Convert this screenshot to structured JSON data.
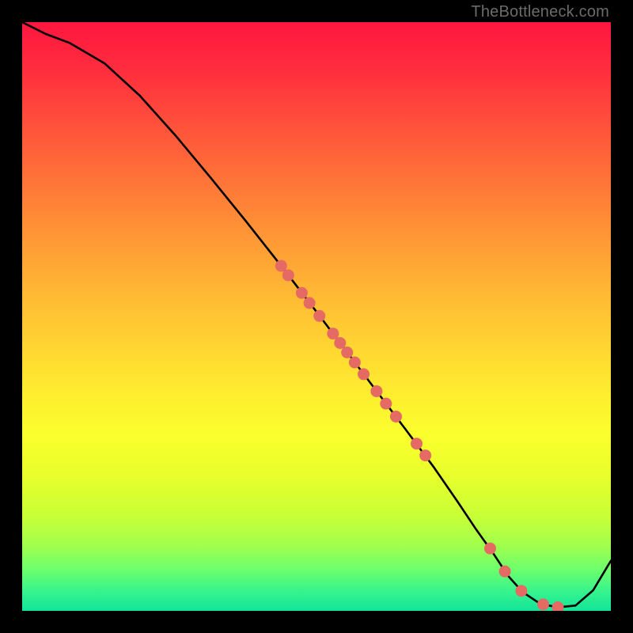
{
  "watermark": "TheBottleneck.com",
  "chart_data": {
    "type": "line",
    "title": "",
    "xlabel": "",
    "ylabel": "",
    "xlim": [
      0,
      100
    ],
    "ylim": [
      0,
      100
    ],
    "grid": false,
    "legend": false,
    "curve": {
      "x": [
        0,
        4,
        8,
        14,
        20,
        26,
        32,
        38,
        44,
        50,
        55,
        60,
        65,
        70,
        74,
        77,
        80,
        82.5,
        85,
        88,
        91,
        94,
        97,
        100
      ],
      "y": [
        100,
        98,
        96.5,
        93,
        87.5,
        80.8,
        73.6,
        66.2,
        58.6,
        50.8,
        44.2,
        37.6,
        31,
        24.3,
        18.5,
        14,
        9.8,
        6,
        3.2,
        1.2,
        0.6,
        0.9,
        3.5,
        8.5
      ]
    },
    "scatter_points": [
      {
        "x": 44.0,
        "y": 58.6
      },
      {
        "x": 45.2,
        "y": 57.0
      },
      {
        "x": 47.5,
        "y": 54.0
      },
      {
        "x": 48.8,
        "y": 52.3
      },
      {
        "x": 50.5,
        "y": 50.1
      },
      {
        "x": 52.8,
        "y": 47.1
      },
      {
        "x": 54.0,
        "y": 45.5
      },
      {
        "x": 55.2,
        "y": 43.9
      },
      {
        "x": 56.5,
        "y": 42.2
      },
      {
        "x": 58.0,
        "y": 40.2
      },
      {
        "x": 60.2,
        "y": 37.3
      },
      {
        "x": 61.8,
        "y": 35.2
      },
      {
        "x": 63.5,
        "y": 33.0
      },
      {
        "x": 67.0,
        "y": 28.4
      },
      {
        "x": 68.5,
        "y": 26.4
      },
      {
        "x": 79.5,
        "y": 10.6
      },
      {
        "x": 82.0,
        "y": 6.7
      },
      {
        "x": 84.8,
        "y": 3.4
      },
      {
        "x": 88.5,
        "y": 1.1
      },
      {
        "x": 91.0,
        "y": 0.6
      }
    ],
    "colors": {
      "curve": "#000000",
      "points_fill": "#e46a63",
      "points_stroke": "#c84f48"
    }
  }
}
